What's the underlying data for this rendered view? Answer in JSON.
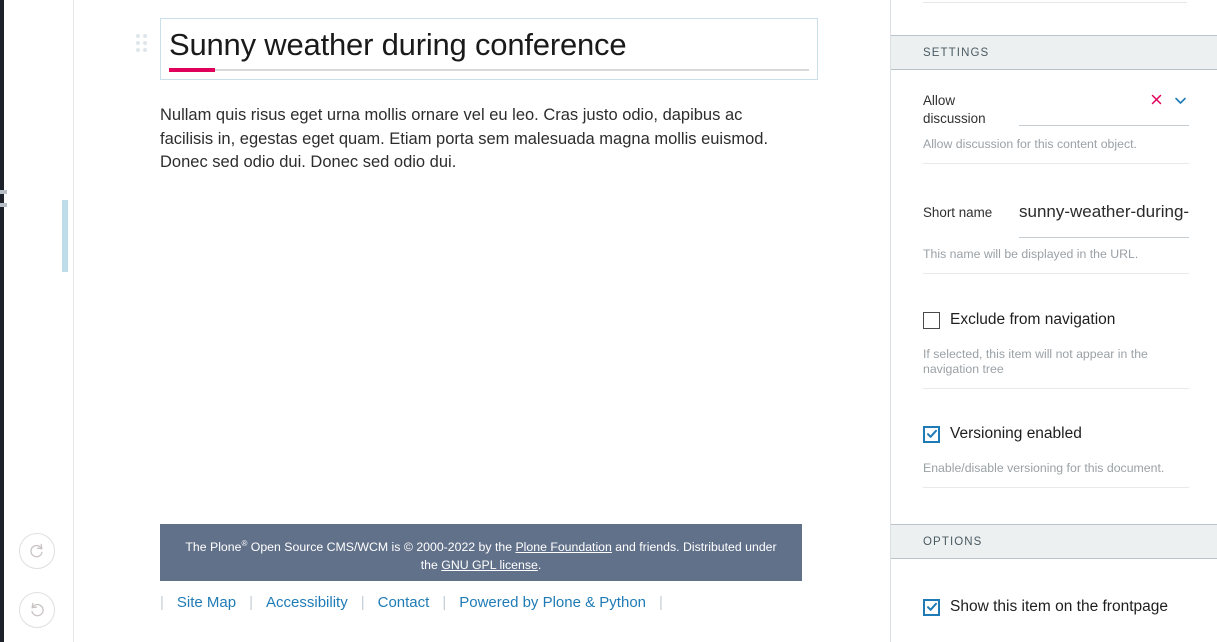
{
  "document": {
    "title_value": "Sunny weather during conference",
    "body_paragraph": "Nullam quis risus eget urna mollis ornare vel eu leo. Cras justo odio, dapibus ac facilisis in, egestas eget quam. Etiam porta sem malesuada magna mollis euismod. Donec sed odio dui. Donec sed odio dui."
  },
  "toolbar": {
    "redo_icon": "redo-icon",
    "undo_icon": "undo-icon",
    "drag_handle_icon": "drag-handle-icon"
  },
  "plone_footer": {
    "text_before_copyright": "The Plone",
    "registered_mark": "®",
    "text_mid": " Open Source CMS/WCM is © 2000-2022 by the ",
    "foundation_link": "Plone Foundation",
    "text_after": " and friends. Distributed under the ",
    "license_link": "GNU GPL license",
    "period": "."
  },
  "footer_nav": {
    "items": [
      {
        "label": "Site Map"
      },
      {
        "label": "Accessibility"
      },
      {
        "label": "Contact"
      },
      {
        "label": "Powered by Plone & Python"
      }
    ],
    "separator": "|"
  },
  "sidebar": {
    "settings_header": "SETTINGS",
    "options_header": "OPTIONS",
    "allow_discussion": {
      "label": "Allow discussion",
      "help": "Allow discussion for this content object.",
      "clear_icon": "close-x-icon",
      "dropdown_icon": "chevron-down-icon",
      "value": ""
    },
    "short_name": {
      "label": "Short name",
      "value": "sunny-weather-during-",
      "help": "This name will be displayed in the URL."
    },
    "exclude_from_navigation": {
      "label": "Exclude from navigation",
      "checked": false,
      "help": "If selected, this item will not appear in the navigation tree"
    },
    "versioning_enabled": {
      "label": "Versioning enabled",
      "checked": true,
      "help": "Enable/disable versioning for this document."
    },
    "show_on_frontpage": {
      "label": "Show this item on the frontpage",
      "checked": true
    }
  },
  "colors": {
    "accent_pink": "#e0005a",
    "accent_blue": "#1f7bb6",
    "footer_bg": "#62718a",
    "section_header_bg": "#ecf0f1",
    "focus_border": "#c9e0ea"
  }
}
